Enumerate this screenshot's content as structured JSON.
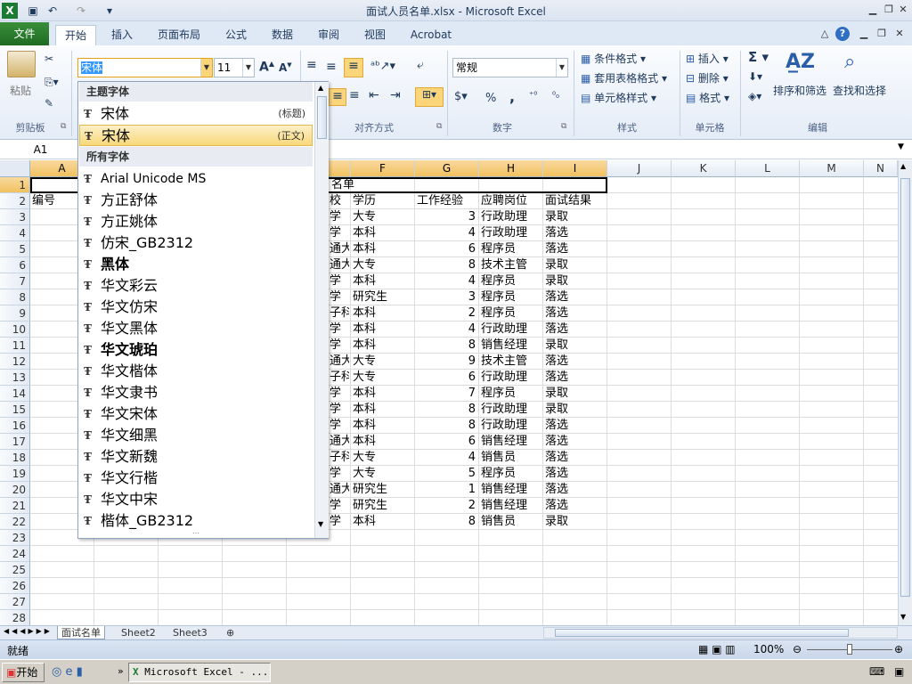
{
  "window": {
    "title": "面试人员名单.xlsx - Microsoft Excel"
  },
  "tabs": {
    "file": "文件",
    "items": [
      "开始",
      "插入",
      "页面布局",
      "公式",
      "数据",
      "审阅",
      "视图",
      "Acrobat"
    ]
  },
  "ribbon": {
    "clipboard": {
      "label": "剪贴板",
      "paste": "粘贴"
    },
    "font": {
      "name": "宋体",
      "size": "11"
    },
    "alignment": {
      "label": "对齐方式"
    },
    "number": {
      "label": "数字",
      "format": "常规",
      "percent": "%",
      "comma": ","
    },
    "styles": {
      "label": "样式",
      "cond": "条件格式",
      "table": "套用表格格式",
      "cell": "单元格样式"
    },
    "cells": {
      "label": "单元格",
      "insert": "插入",
      "delete": "删除",
      "format": "格式"
    },
    "editing": {
      "label": "编辑",
      "sum": "Σ",
      "sort": "排序和筛选",
      "find": "查找和选择"
    }
  },
  "formula": {
    "namebox": "A1"
  },
  "columns": [
    "A",
    "B",
    "C",
    "D",
    "E",
    "F",
    "G",
    "H",
    "I",
    "J",
    "K",
    "L",
    "M",
    "N"
  ],
  "rows": [
    "1",
    "2",
    "3",
    "4",
    "5",
    "6",
    "7",
    "8",
    "9",
    "10",
    "11",
    "12",
    "13",
    "14",
    "15",
    "16",
    "17",
    "18",
    "19",
    "20",
    "21",
    "22",
    "23",
    "24",
    "25",
    "26",
    "27",
    "28"
  ],
  "sheet": {
    "title": "名单",
    "header": {
      "a": "编号",
      "e": "校",
      "f": "学历",
      "g": "工作经验",
      "h": "应聘岗位",
      "i": "面试结果"
    },
    "data": [
      {
        "e": "学",
        "f": "大专",
        "g": "3",
        "h": "行政助理",
        "i": "录取"
      },
      {
        "e": "学",
        "f": "本科",
        "g": "4",
        "h": "行政助理",
        "i": "落选"
      },
      {
        "e": "通大",
        "f": "本科",
        "g": "6",
        "h": "程序员",
        "i": "落选"
      },
      {
        "e": "通大",
        "f": "大专",
        "g": "8",
        "h": "技术主管",
        "i": "录取"
      },
      {
        "e": "学",
        "f": "本科",
        "g": "4",
        "h": "程序员",
        "i": "录取"
      },
      {
        "e": "学",
        "f": "研究生",
        "g": "3",
        "h": "程序员",
        "i": "落选"
      },
      {
        "e": "子科",
        "f": "本科",
        "g": "2",
        "h": "程序员",
        "i": "落选"
      },
      {
        "e": "学",
        "f": "本科",
        "g": "4",
        "h": "行政助理",
        "i": "落选"
      },
      {
        "e": "学",
        "f": "本科",
        "g": "8",
        "h": "销售经理",
        "i": "录取"
      },
      {
        "e": "通大",
        "f": "大专",
        "g": "9",
        "h": "技术主管",
        "i": "落选"
      },
      {
        "e": "子科",
        "f": "大专",
        "g": "6",
        "h": "行政助理",
        "i": "落选"
      },
      {
        "e": "学",
        "f": "本科",
        "g": "7",
        "h": "程序员",
        "i": "录取"
      },
      {
        "e": "学",
        "f": "本科",
        "g": "8",
        "h": "行政助理",
        "i": "录取"
      },
      {
        "e": "学",
        "f": "本科",
        "g": "8",
        "h": "行政助理",
        "i": "落选"
      },
      {
        "e": "通大",
        "f": "本科",
        "g": "6",
        "h": "销售经理",
        "i": "落选"
      },
      {
        "e": "子科",
        "f": "大专",
        "g": "4",
        "h": "销售员",
        "i": "落选"
      },
      {
        "e": "学",
        "f": "大专",
        "g": "5",
        "h": "程序员",
        "i": "落选"
      },
      {
        "e": "通大",
        "f": "研究生",
        "g": "1",
        "h": "销售经理",
        "i": "落选"
      },
      {
        "e": "学",
        "f": "研究生",
        "g": "2",
        "h": "销售经理",
        "i": "落选"
      },
      {
        "e": "学",
        "f": "本科",
        "g": "8",
        "h": "销售员",
        "i": "录取"
      }
    ]
  },
  "fontDropdown": {
    "themeHeader": "主题字体",
    "theme": [
      {
        "name": "宋体",
        "tag": "(标题)"
      },
      {
        "name": "宋体",
        "tag": "(正文)"
      }
    ],
    "allHeader": "所有字体",
    "fonts": [
      "Arial Unicode MS",
      "方正舒体",
      "方正姚体",
      "仿宋_GB2312",
      "黑体",
      "华文彩云",
      "华文仿宋",
      "华文黑体",
      "华文琥珀",
      "华文楷体",
      "华文隶书",
      "华文宋体",
      "华文细黑",
      "华文新魏",
      "华文行楷",
      "华文中宋",
      "楷体_GB2312"
    ]
  },
  "sheetTabs": [
    "面试名单",
    "Sheet2",
    "Sheet3"
  ],
  "status": {
    "ready": "就绪",
    "zoom": "100%"
  },
  "taskbar": {
    "start": "开始",
    "task": "Microsoft Excel - ..."
  }
}
